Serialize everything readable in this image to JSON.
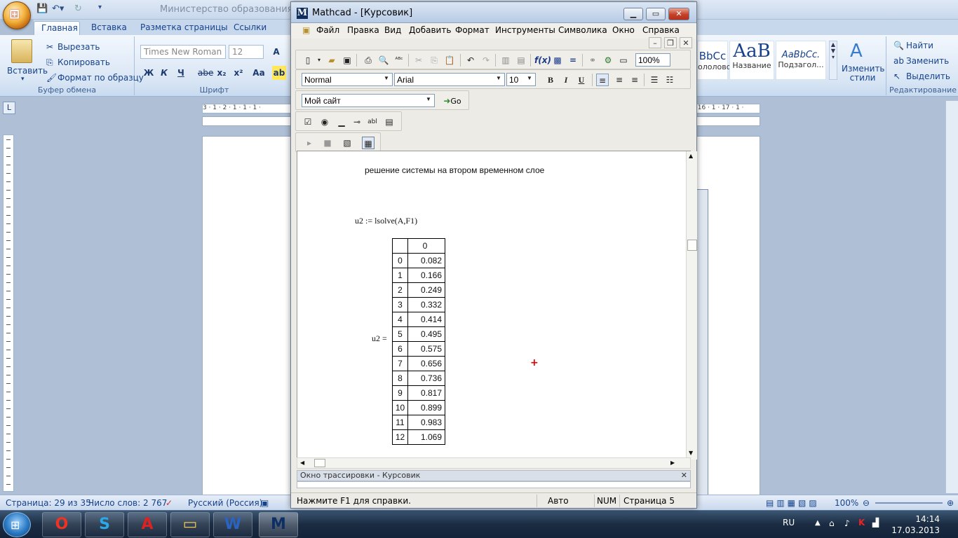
{
  "word": {
    "doc_title": "Министерство образования и нау",
    "tabs": [
      "Главная",
      "Вставка",
      "Разметка страницы",
      "Ссылки"
    ],
    "clipboard": {
      "paste": "Вставить",
      "cut": "Вырезать",
      "copy": "Копировать",
      "format_painter": "Формат по образцу",
      "group": "Буфер обмена"
    },
    "font": {
      "name": "Times New Roman",
      "size": "12",
      "group": "Шрифт",
      "bold": "Ж",
      "italic": "К",
      "underline": "Ч",
      "strike": "abe",
      "sub": "x₂",
      "sup": "x²",
      "case": "Aa"
    },
    "styles": {
      "tile1": "BbCc",
      "tile1_name": "ололово...",
      "tile2": "AaB",
      "tile2_name": "Название",
      "tile3": "AaBbCc.",
      "tile3_name": "Подзагол...",
      "change": "Изменить стили"
    },
    "editing": {
      "find": "Найти",
      "replace": "Заменить",
      "select": "Выделить",
      "group": "Редактирование"
    },
    "ruler": {
      "left": "3 · 1 · 2 · 1 · 1 · 1 ·",
      "right": "· 16 · 1 · 17 · 1 ·"
    },
    "status": {
      "page": "Страница: 29 из 35",
      "words": "Число слов: 2 767",
      "lang": "Русский (Россия)",
      "zoom": "100%"
    }
  },
  "mathcad": {
    "title": "Mathcad - [Курсовик]",
    "menu": [
      "Файл",
      "Правка",
      "Вид",
      "Добавить",
      "Формат",
      "Инструменты",
      "Символика",
      "Окно",
      "Справка"
    ],
    "toolbar": {
      "zoom": "100%",
      "style": "Normal",
      "font": "Arial",
      "size": "10",
      "bold": "B",
      "italic": "I",
      "underline": "U"
    },
    "resources": {
      "site": "Мой сайт",
      "go": "Go"
    },
    "worksheet": {
      "heading": "решение системы на втором временном слое",
      "formula": "u2 := lsolve(A,F1)",
      "result_label": "u2 =",
      "col_header": "0",
      "rows": [
        {
          "i": "0",
          "v": "0.082"
        },
        {
          "i": "1",
          "v": "0.166"
        },
        {
          "i": "2",
          "v": "0.249"
        },
        {
          "i": "3",
          "v": "0.332"
        },
        {
          "i": "4",
          "v": "0.414"
        },
        {
          "i": "5",
          "v": "0.495"
        },
        {
          "i": "6",
          "v": "0.575"
        },
        {
          "i": "7",
          "v": "0.656"
        },
        {
          "i": "8",
          "v": "0.736"
        },
        {
          "i": "9",
          "v": "0.817"
        },
        {
          "i": "10",
          "v": "0.899"
        },
        {
          "i": "11",
          "v": "0.983"
        },
        {
          "i": "12",
          "v": "1.069"
        }
      ]
    },
    "trace_title": "Окно трассировки - Курсовик",
    "status": {
      "help": "Нажмите F1 для справки.",
      "mode": "Авто",
      "num": "NUM",
      "page": "Страница 5"
    }
  },
  "taskbar": {
    "lang": "RU",
    "time": "14:14",
    "date": "17.03.2013"
  }
}
